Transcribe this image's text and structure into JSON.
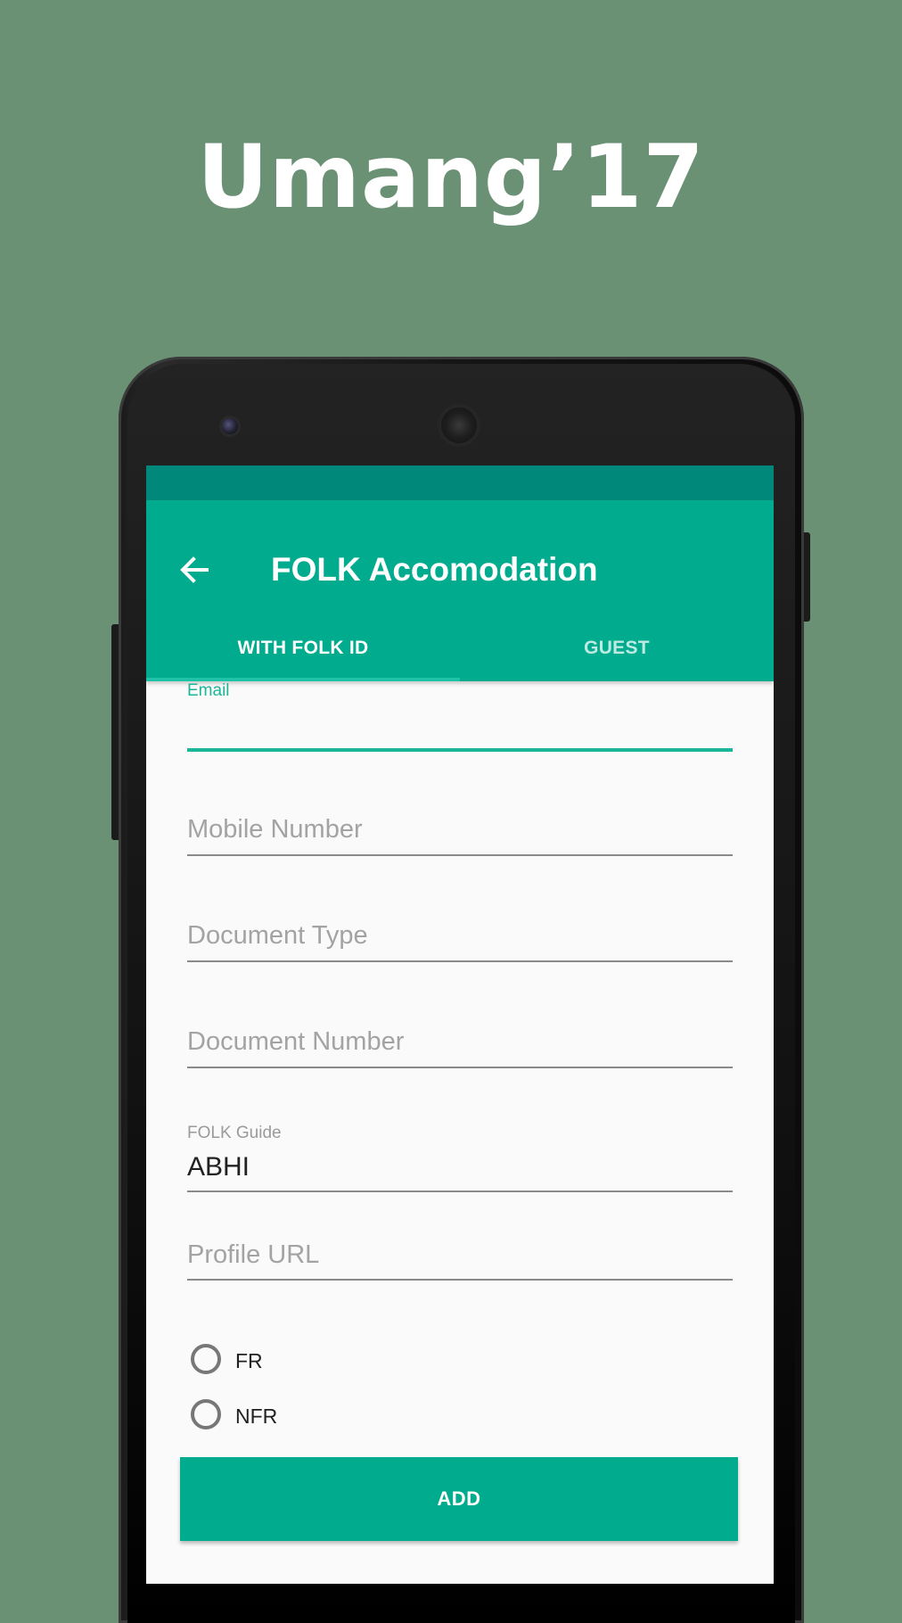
{
  "promo": {
    "title": "Umang’17"
  },
  "appbar": {
    "title": "FOLK Accomodation",
    "back_icon": "arrow-back-icon"
  },
  "tabs": [
    {
      "label": "WITH FOLK ID",
      "active": true
    },
    {
      "label": "GUEST",
      "active": false
    }
  ],
  "form": {
    "email": {
      "label": "Email",
      "value": ""
    },
    "mobile": {
      "placeholder": "Mobile Number"
    },
    "doc_type": {
      "placeholder": "Document Type"
    },
    "doc_number": {
      "placeholder": "Document Number"
    },
    "guide": {
      "label": "FOLK Guide",
      "value": "ABHI"
    },
    "profile_url": {
      "placeholder": "Profile URL"
    },
    "radio_options": [
      {
        "label": "FR",
        "selected": false
      },
      {
        "label": "NFR",
        "selected": false
      }
    ]
  },
  "actions": {
    "add_label": "ADD"
  },
  "colors": {
    "background": "#6b9175",
    "primary": "#00ab8e",
    "primary_dark": "#00897b",
    "accent": "#1bb698"
  }
}
